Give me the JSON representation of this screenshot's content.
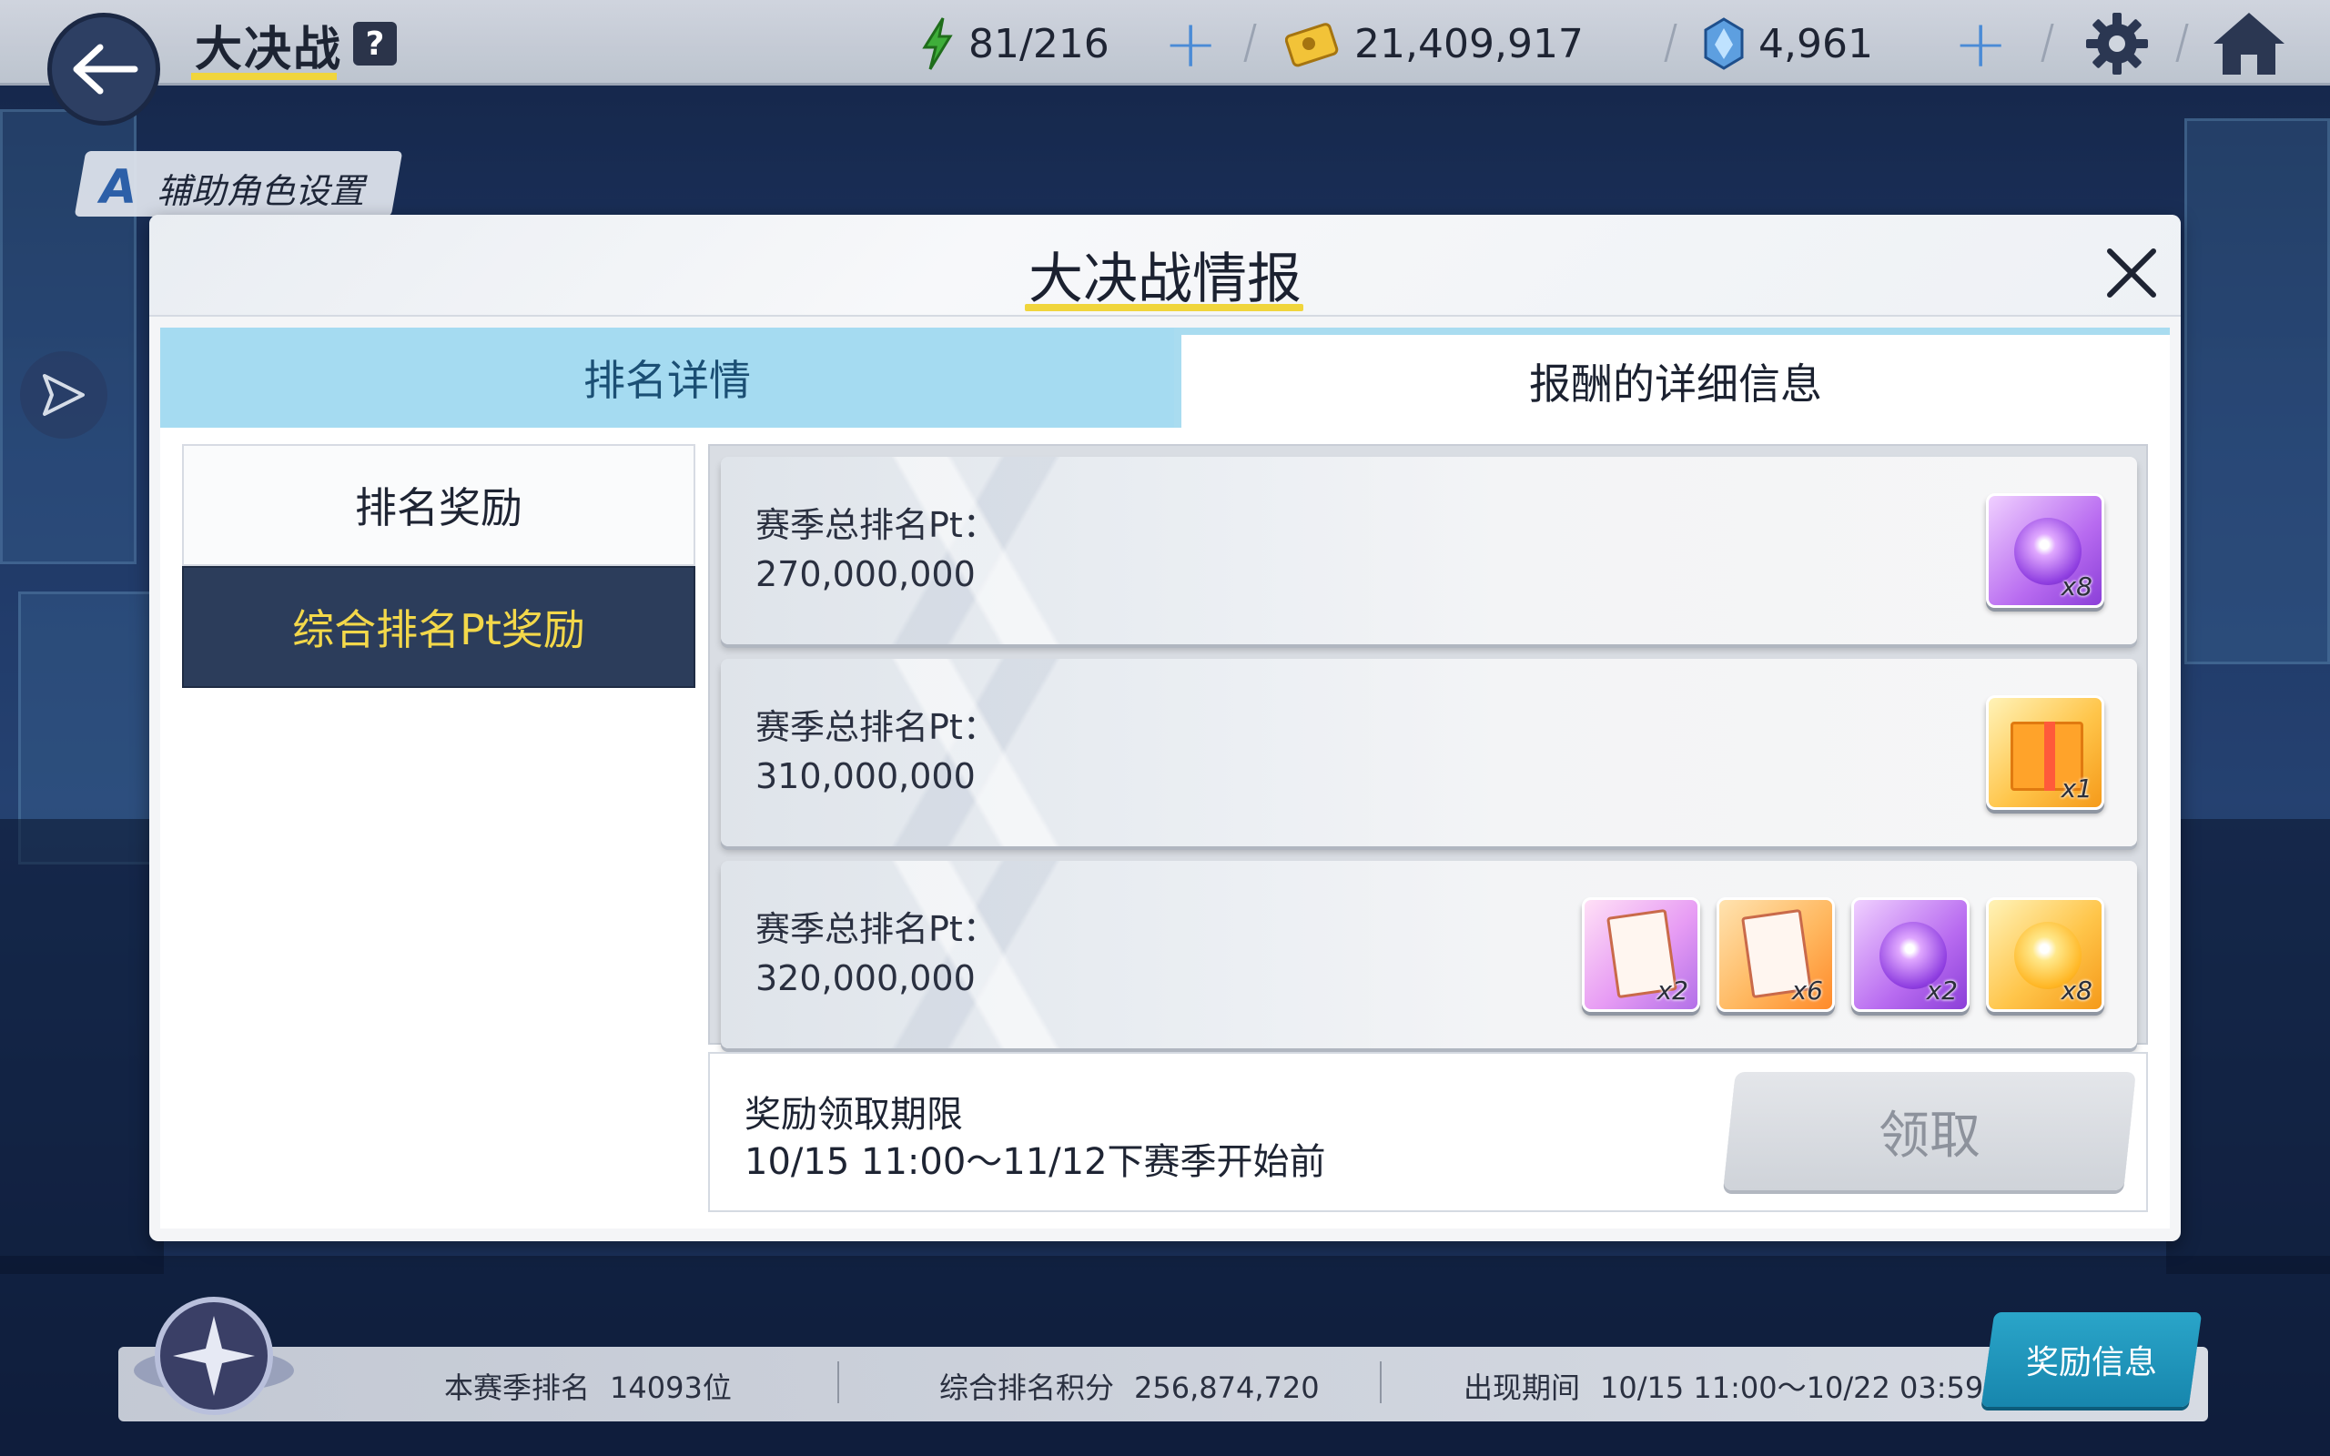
{
  "header": {
    "title": "大决战",
    "help_label": "?",
    "stamina": "81/216",
    "credits": "21,409,917",
    "gems": "4,961"
  },
  "support_tab": {
    "icon_letter": "A",
    "label": "辅助角色设置"
  },
  "modal": {
    "title": "大决战情报",
    "tabs": [
      {
        "label": "排名详情"
      },
      {
        "label": "报酬的详细信息"
      }
    ],
    "menu": [
      {
        "label": "排名奖励"
      },
      {
        "label": "综合排名Pt奖励"
      }
    ],
    "rewards": [
      {
        "label": "赛季总排名Pt：",
        "threshold": "270,000,000",
        "items": [
          {
            "icon": "purple-orb-icon",
            "qty": "x8"
          }
        ]
      },
      {
        "label": "赛季总排名Pt：",
        "threshold": "310,000,000",
        "items": [
          {
            "icon": "gift-box-icon",
            "qty": "x1"
          }
        ]
      },
      {
        "label": "赛季总排名Pt：",
        "threshold": "320,000,000",
        "items": [
          {
            "icon": "pink-report-icon",
            "qty": "x2"
          },
          {
            "icon": "orange-report-icon",
            "qty": "x6"
          },
          {
            "icon": "purple-orb-icon",
            "qty": "x2"
          },
          {
            "icon": "gold-orb-icon",
            "qty": "x8"
          }
        ]
      }
    ],
    "claim": {
      "title": "奖励领取期限",
      "period": "10/15 11:00～11/12下赛季开始前",
      "button_label": "领取"
    }
  },
  "footer": {
    "season_rank_label": "本赛季排名",
    "season_rank_value": "14093位",
    "points_label": "综合排名积分",
    "points_value": "256,874,720",
    "period_label": "出现期间",
    "period_value": "10/15 11:00～10/22 03:59",
    "reward_info_label": "奖励信息"
  },
  "colors": {
    "accent_yellow": "#f0d53c",
    "active_menu_bg": "#2c3d5b",
    "tab_blue": "#a5dbf1",
    "reward_info_btn": "#1f95bb"
  }
}
